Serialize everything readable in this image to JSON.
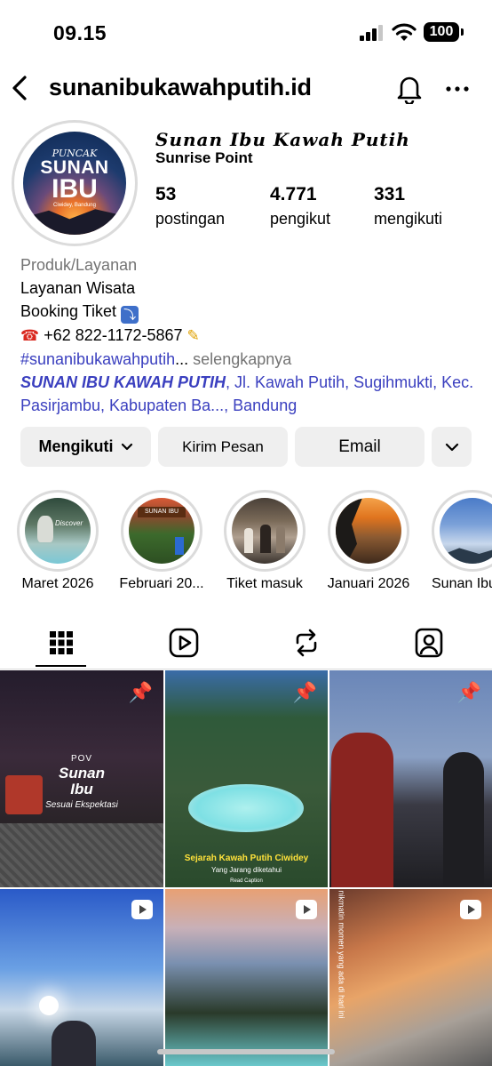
{
  "status": {
    "time": "09.15",
    "battery": "100"
  },
  "header": {
    "username": "sunanibukawahputih.id"
  },
  "profile": {
    "avatar": {
      "line1": "PUNCAK",
      "line2": "SUNAN",
      "line3": "IBU",
      "line4": "Ciwidey, Bandung"
    },
    "display_name": "Sunan Ibu Kawah Putih",
    "sub_name": "Sunrise Point",
    "stats": [
      {
        "num": "53",
        "label": "postingan"
      },
      {
        "num": "4.771",
        "label": "pengikut"
      },
      {
        "num": "331",
        "label": "mengikuti"
      }
    ],
    "bio": {
      "category": "Produk/Layanan",
      "line1": "Layanan Wisata",
      "line2": "Booking Tiket",
      "phone": "+62 822-1172-5867",
      "hashtag": "#sunanibukawahputih",
      "ellipsis": "...",
      "more": "selengkapnya",
      "location_name": "SUNAN IBU KAWAH PUTIH",
      "location_rest": ", Jl. Kawah Putih, Sugihmukti, Kec. Pasirjambu, Kabupaten Ba..., Bandung"
    }
  },
  "buttons": {
    "following": "Mengikuti",
    "message": "Kirim Pesan",
    "email": "Email"
  },
  "highlights": [
    {
      "label": "Maret 2026"
    },
    {
      "label": "Februari 20..."
    },
    {
      "label": "Tiket masuk"
    },
    {
      "label": "Januari 2026"
    },
    {
      "label": "Sunan Ibu"
    }
  ],
  "highlight_texts": {
    "h2_sign": "SUNAN IBU",
    "h1_caption": "Discover"
  },
  "posts": {
    "p1": {
      "pov": "POV",
      "title1": "Sunan",
      "title2": "Ibu",
      "sub": "Sesuai Ekspektasi"
    },
    "p2": {
      "title": "Sejarah Kawah Putih Ciwidey",
      "sub": "Yang Jarang diketahui",
      "note": "Read Caption"
    },
    "p6": {
      "vertical": "nikmatin momen yang ada di hari ini"
    }
  },
  "icons": [
    "back-arrow-icon",
    "bell-icon",
    "more-icon",
    "grid-icon",
    "reels-icon",
    "reposts-icon",
    "tagged-icon",
    "pin-icon",
    "reel-play-icon"
  ]
}
